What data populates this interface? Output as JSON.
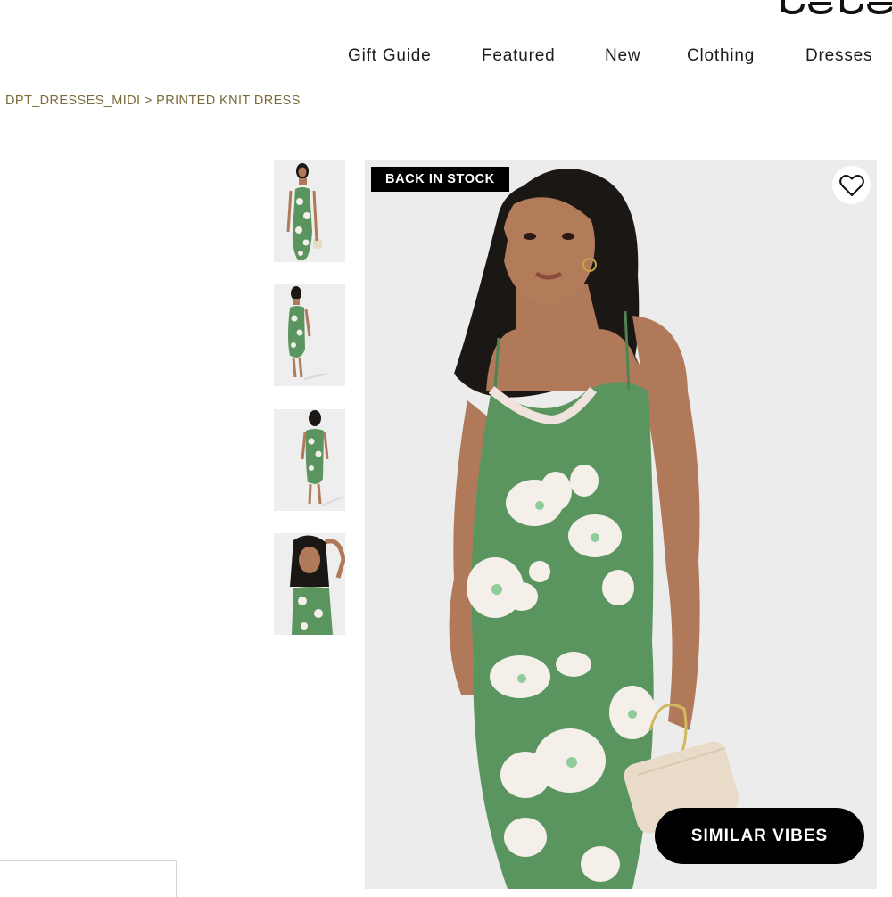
{
  "brand": {
    "logo_text": "bebe"
  },
  "nav": {
    "items": [
      {
        "label": "Gift Guide"
      },
      {
        "label": "Featured"
      },
      {
        "label": "New"
      },
      {
        "label": "Clothing"
      },
      {
        "label": "Dresses"
      }
    ]
  },
  "breadcrumb": {
    "category": "DPT_DRESSES_MIDI",
    "separator": ">",
    "current": "PRINTED KNIT DRESS"
  },
  "product": {
    "badge": "BACK IN STOCK",
    "wishlist_icon": "heart-outline-icon",
    "similar_button": "SIMILAR VIBES",
    "thumbnail_count": 4
  },
  "colors": {
    "dress_green": "#5a9560",
    "flower_white": "#f4efe9",
    "breadcrumb_gold": "#7a6a3a",
    "image_bg": "#ececec"
  }
}
